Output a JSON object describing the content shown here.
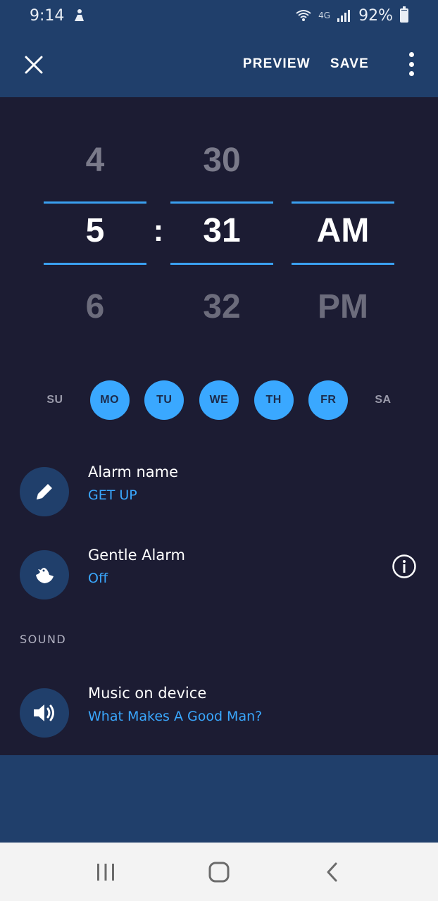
{
  "status_bar": {
    "time": "9:14",
    "network": "4G",
    "battery": "92%"
  },
  "toolbar": {
    "preview_label": "PREVIEW",
    "save_label": "SAVE"
  },
  "picker": {
    "hour": {
      "prev": "4",
      "selected": "5",
      "next": "6"
    },
    "minute": {
      "prev": "30",
      "selected": "31",
      "next": "32"
    },
    "period": {
      "prev": "",
      "selected": "AM",
      "next": "PM"
    },
    "separator": ":"
  },
  "days": [
    {
      "label": "SU",
      "active": false
    },
    {
      "label": "MO",
      "active": true
    },
    {
      "label": "TU",
      "active": true
    },
    {
      "label": "WE",
      "active": true
    },
    {
      "label": "TH",
      "active": true
    },
    {
      "label": "FR",
      "active": true
    },
    {
      "label": "SA",
      "active": false
    }
  ],
  "settings": {
    "alarm_name": {
      "title": "Alarm name",
      "value": "GET UP",
      "icon": "pencil-icon"
    },
    "gentle_alarm": {
      "title": "Gentle Alarm",
      "value": "Off",
      "icon": "bird-icon"
    }
  },
  "sound": {
    "section_label": "SOUND",
    "music": {
      "title": "Music on device",
      "value": "What Makes A Good Man?",
      "icon": "speaker-icon"
    }
  },
  "colors": {
    "background": "#1c1c33",
    "header": "#203f6b",
    "accent": "#3aa8ff",
    "picker_line": "#3aa0f0"
  }
}
